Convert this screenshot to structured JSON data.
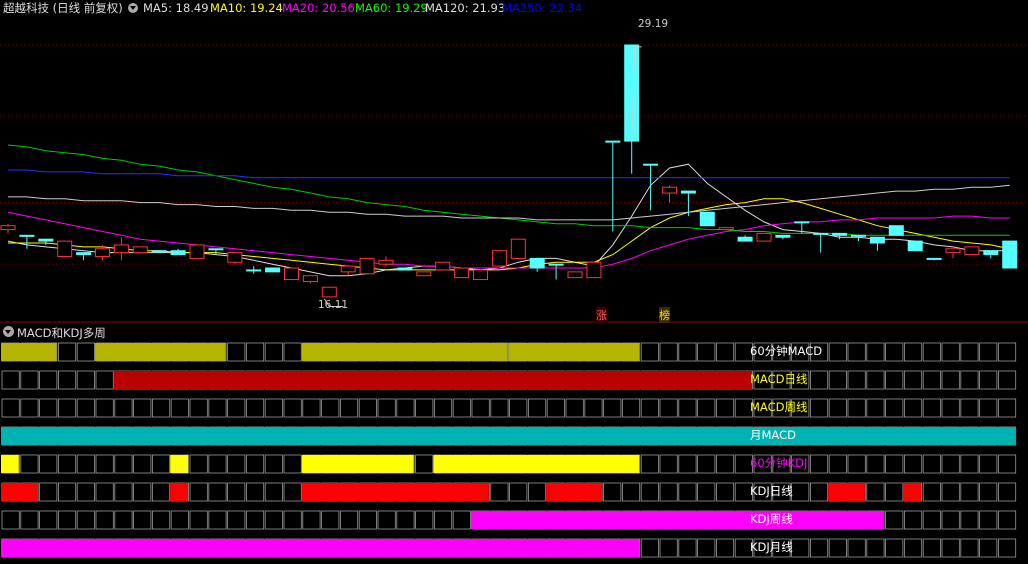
{
  "header": {
    "stock_title": "超越科技 (日线 前复权)",
    "ma_items": [
      {
        "label": "MA5: 18.49",
        "color": "#dddddd"
      },
      {
        "label": "MA10: 19.24",
        "color": "#ffff00"
      },
      {
        "label": "MA20: 20.56",
        "color": "#ff00ff"
      },
      {
        "label": "MA60: 19.29",
        "color": "#00ff00"
      },
      {
        "label": "MA120: 21.93",
        "color": "#dddddd"
      },
      {
        "label": "MA250: 22.34",
        "color": "#0000ff"
      }
    ]
  },
  "price_labels": {
    "high": "29.19",
    "low": "16.11"
  },
  "markers": {
    "zhang": "涨",
    "bang": "榜"
  },
  "chart_data": {
    "type": "candlestick",
    "y_range": [
      15.0,
      30.5
    ],
    "candles": [
      [
        19.6,
        19.8,
        19.4,
        19.9
      ],
      [
        19.3,
        19.3,
        18.7,
        18.6
      ],
      [
        19.1,
        19.0,
        18.8,
        18.9
      ],
      [
        18.2,
        19.0,
        18.2,
        19.0
      ],
      [
        18.4,
        18.3,
        18.0,
        18.4
      ],
      [
        18.2,
        18.6,
        18.8,
        18.0
      ],
      [
        18.4,
        18.8,
        18.0,
        19.2
      ],
      [
        18.4,
        18.7,
        18.4,
        18.5
      ],
      [
        18.5,
        18.5,
        18.5,
        18.4
      ],
      [
        18.5,
        18.3,
        18.3,
        18.6
      ],
      [
        18.1,
        18.8,
        18.1,
        18.8
      ],
      [
        18.6,
        18.6,
        18.4,
        18.3
      ],
      [
        17.9,
        18.4,
        17.8,
        18.2
      ],
      [
        17.5,
        17.5,
        17.3,
        17.7
      ],
      [
        17.6,
        17.4,
        17.5,
        17.4
      ],
      [
        17.0,
        17.6,
        17.0,
        17.6
      ],
      [
        16.9,
        17.2,
        16.8,
        17.2
      ],
      [
        16.1,
        16.6,
        16.1,
        16.6
      ],
      [
        17.4,
        17.7,
        17.2,
        17.4
      ],
      [
        17.3,
        18.1,
        17.7,
        18.1
      ],
      [
        17.8,
        18.0,
        17.7,
        18.2
      ],
      [
        17.6,
        17.5,
        17.6,
        17.6
      ],
      [
        17.2,
        17.4,
        17.4,
        17.4
      ],
      [
        17.5,
        17.9,
        17.5,
        17.9
      ],
      [
        17.1,
        17.6,
        17.1,
        17.6
      ],
      [
        17.0,
        17.5,
        17.0,
        17.5
      ],
      [
        17.7,
        18.5,
        17.7,
        18.5
      ],
      [
        18.1,
        19.1,
        18.1,
        19.1
      ],
      [
        18.1,
        17.6,
        17.4,
        17.7
      ],
      [
        17.8,
        17.8,
        17.0,
        17.5
      ],
      [
        17.1,
        17.4,
        17.1,
        17.4
      ],
      [
        17.1,
        17.9,
        17.3,
        17.9
      ],
      [
        24.2,
        24.2,
        20.0,
        19.5
      ],
      [
        29.2,
        24.2,
        22.5,
        23.2
      ],
      [
        23.0,
        23.0,
        20.6,
        21.1
      ],
      [
        21.5,
        21.8,
        21.0,
        21.9
      ],
      [
        21.6,
        21.5,
        20.3,
        20.5
      ],
      [
        20.5,
        19.8,
        19.8,
        19.8
      ],
      [
        19.6,
        19.7,
        19.6,
        19.6
      ],
      [
        19.2,
        19.0,
        19.0,
        19.3
      ],
      [
        19.0,
        19.4,
        19.1,
        19.4
      ],
      [
        19.3,
        19.2,
        19.1,
        19.3
      ],
      [
        20.0,
        20.0,
        19.6,
        19.4
      ],
      [
        19.4,
        19.4,
        19.3,
        18.4
      ],
      [
        19.4,
        19.3,
        19.2,
        19.1
      ],
      [
        19.3,
        19.3,
        19.0,
        19.0
      ],
      [
        19.2,
        18.9,
        19.1,
        18.5
      ],
      [
        19.8,
        19.3,
        19.3,
        19.3
      ],
      [
        19.0,
        18.5,
        18.5,
        18.6
      ],
      [
        18.1,
        18.1,
        18.1,
        18.0
      ],
      [
        18.4,
        18.6,
        18.1,
        18.6
      ],
      [
        18.3,
        18.7,
        18.3,
        18.3
      ],
      [
        18.5,
        18.3,
        18.1,
        18.3
      ],
      [
        19.0,
        17.6,
        17.7,
        17.6
      ]
    ],
    "ma_lines": {
      "MA5": [
        19.0,
        18.8,
        18.7,
        18.6,
        18.5,
        18.4,
        18.4,
        18.4,
        18.4,
        18.4,
        18.4,
        18.3,
        18.2,
        18.0,
        17.8,
        17.6,
        17.4,
        17.2,
        17.2,
        17.3,
        17.5,
        17.6,
        17.7,
        17.7,
        17.6,
        17.5,
        17.6,
        17.9,
        18.1,
        18.1,
        17.9,
        17.7,
        18.8,
        20.3,
        21.9,
        22.8,
        23.0,
        22.0,
        21.3,
        20.6,
        20.0,
        19.6,
        19.5,
        19.4,
        19.2,
        19.2,
        19.1,
        19.1,
        19.0,
        18.8,
        18.7,
        18.5,
        18.5,
        18.5
      ],
      "MA10": [
        18.9,
        18.9,
        18.9,
        18.8,
        18.7,
        18.7,
        18.6,
        18.5,
        18.5,
        18.4,
        18.4,
        18.4,
        18.3,
        18.2,
        18.1,
        18.0,
        17.9,
        17.8,
        17.7,
        17.6,
        17.5,
        17.5,
        17.5,
        17.5,
        17.5,
        17.5,
        17.5,
        17.6,
        17.8,
        17.9,
        17.9,
        17.9,
        18.3,
        19.0,
        19.7,
        20.2,
        20.5,
        20.7,
        20.9,
        21.0,
        21.2,
        21.2,
        21.0,
        20.7,
        20.4,
        20.1,
        19.8,
        19.6,
        19.4,
        19.2,
        19.0,
        18.9,
        18.8,
        18.6
      ],
      "MA20": [
        20.5,
        20.3,
        20.1,
        19.9,
        19.7,
        19.5,
        19.3,
        19.1,
        19.0,
        18.9,
        18.8,
        18.7,
        18.6,
        18.5,
        18.4,
        18.3,
        18.2,
        18.1,
        18.0,
        17.9,
        17.8,
        17.8,
        17.7,
        17.7,
        17.6,
        17.6,
        17.6,
        17.6,
        17.6,
        17.6,
        17.6,
        17.6,
        17.8,
        18.1,
        18.5,
        18.8,
        19.1,
        19.3,
        19.5,
        19.6,
        19.8,
        19.9,
        20.0,
        20.0,
        20.1,
        20.1,
        20.2,
        20.2,
        20.2,
        20.2,
        20.3,
        20.3,
        20.2,
        20.2
      ],
      "MA60": [
        24.0,
        23.9,
        23.7,
        23.6,
        23.5,
        23.3,
        23.2,
        23.0,
        22.9,
        22.7,
        22.6,
        22.4,
        22.2,
        22.0,
        21.8,
        21.7,
        21.5,
        21.3,
        21.2,
        21.0,
        20.9,
        20.8,
        20.6,
        20.5,
        20.4,
        20.3,
        20.2,
        20.1,
        20.0,
        19.9,
        19.9,
        19.8,
        19.8,
        19.8,
        19.7,
        19.7,
        19.7,
        19.6,
        19.6,
        19.5,
        19.5,
        19.4,
        19.4,
        19.4,
        19.4,
        19.3,
        19.3,
        19.3,
        19.3,
        19.3,
        19.3,
        19.3,
        19.3,
        19.3
      ],
      "MA120": [
        21.3,
        21.3,
        21.2,
        21.2,
        21.1,
        21.1,
        21.1,
        21.0,
        21.0,
        20.9,
        20.9,
        20.8,
        20.8,
        20.7,
        20.7,
        20.6,
        20.6,
        20.5,
        20.5,
        20.4,
        20.4,
        20.3,
        20.3,
        20.3,
        20.2,
        20.2,
        20.2,
        20.2,
        20.1,
        20.1,
        20.1,
        20.1,
        20.1,
        20.2,
        20.3,
        20.4,
        20.5,
        20.6,
        20.7,
        20.8,
        20.9,
        21.0,
        21.1,
        21.2,
        21.3,
        21.4,
        21.5,
        21.6,
        21.6,
        21.7,
        21.7,
        21.8,
        21.8,
        21.9
      ],
      "MA250": [
        22.7,
        22.7,
        22.6,
        22.6,
        22.6,
        22.5,
        22.5,
        22.5,
        22.5,
        22.4,
        22.4,
        22.4,
        22.4,
        22.3,
        22.3,
        22.3,
        22.3,
        22.3,
        22.3,
        22.3,
        22.3,
        22.3,
        22.3,
        22.3,
        22.3,
        22.3,
        22.3,
        22.3,
        22.3,
        22.3,
        22.3,
        22.3,
        22.3,
        22.3,
        22.3,
        22.3,
        22.3,
        22.3,
        22.3,
        22.3,
        22.3,
        22.3,
        22.3,
        22.3,
        22.3,
        22.3,
        22.3,
        22.3,
        22.3,
        22.3,
        22.3,
        22.3,
        22.3,
        22.3
      ]
    }
  },
  "panel": {
    "title": "MACD和KDJ多周",
    "cell_count": 54,
    "rows": [
      {
        "label": "60分钟MACD",
        "label_color": "#ffffff",
        "color": "#b5b500",
        "segments": [
          [
            0,
            2
          ],
          [
            5,
            11
          ],
          [
            16,
            26
          ],
          [
            27,
            33
          ]
        ]
      },
      {
        "label": "MACD日线",
        "label_color": "#ffff00",
        "color": "#bb0000",
        "segments": [
          [
            6,
            39
          ]
        ]
      },
      {
        "label": "MACD周线",
        "label_color": "#ffff00",
        "color": "#000000",
        "segments": []
      },
      {
        "label": "月MACD",
        "label_color": "#ffffff",
        "color": "#00b3b3",
        "segments": [
          [
            0,
            53
          ]
        ]
      },
      {
        "label": "60分钟KDJ",
        "label_color": "#ff00ff",
        "color": "#ffff00",
        "segments": [
          [
            0,
            0
          ],
          [
            9,
            9
          ],
          [
            16,
            21
          ],
          [
            23,
            33
          ]
        ]
      },
      {
        "label": "KDJ日线",
        "label_color": "#ffffff",
        "color": "#ff0000",
        "segments": [
          [
            0,
            1
          ],
          [
            9,
            9
          ],
          [
            16,
            25
          ],
          [
            29,
            31
          ],
          [
            44,
            45
          ],
          [
            48,
            48
          ]
        ]
      },
      {
        "label": "KDJ周线",
        "label_color": "#ffffff",
        "color": "#ff00ff",
        "segments": [
          [
            25,
            46
          ]
        ]
      },
      {
        "label": "KDJ月线",
        "label_color": "#ffffff",
        "color": "#ff00ff",
        "segments": [
          [
            0,
            33
          ]
        ]
      }
    ]
  }
}
